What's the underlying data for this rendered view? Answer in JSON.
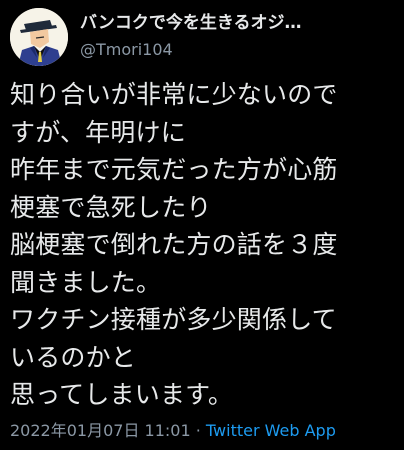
{
  "user": {
    "display_name": "バンコクで今を生きるオジ…",
    "handle": "@Tmori104"
  },
  "tweet": {
    "lines": [
      "知り合いが非常に少ないので",
      "すが、年明けに",
      "昨年まで元気だった方が心筋",
      "梗塞で急死したり",
      "脳梗塞で倒れた方の話を３度",
      "聞きました。",
      "ワクチン接種が多少関係して",
      "いるのかと",
      "思ってしまいます。"
    ]
  },
  "meta": {
    "timestamp": "2022年01月07日 11:01",
    "separator": " · ",
    "source": "Twitter Web App"
  },
  "colors": {
    "background": "#000000",
    "text": "#e7e9ea",
    "secondary": "#8b98a5",
    "accent": "#1d9bf0"
  },
  "icons": {
    "avatar": "lupin-cartoon-avatar-icon"
  }
}
